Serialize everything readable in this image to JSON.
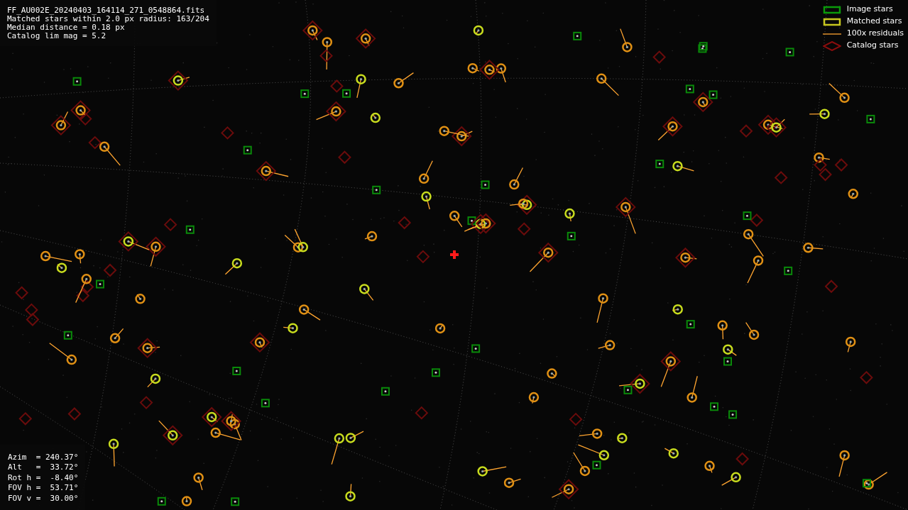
{
  "header": {
    "lines": [
      "FF_AU002E_20240403_164114_271_0548864.fits",
      "Matched stars within 2.0 px radius: 163/204",
      "Median distance = 0.18 px",
      "Catalog lim mag = 5.2"
    ]
  },
  "legend": [
    {
      "kind": "image",
      "label": "Image stars"
    },
    {
      "kind": "matched",
      "label": "Matched stars"
    },
    {
      "kind": "residual",
      "label": "100x residuals"
    },
    {
      "kind": "catalog",
      "label": "Catalog stars"
    }
  ],
  "pointing": {
    "lines": [
      "Azim  = 240.37°",
      "Alt   =  33.72°",
      "Rot h =  -8.40°",
      "FOV h =  53.71°",
      "FOV v =  30.00°"
    ]
  }
}
